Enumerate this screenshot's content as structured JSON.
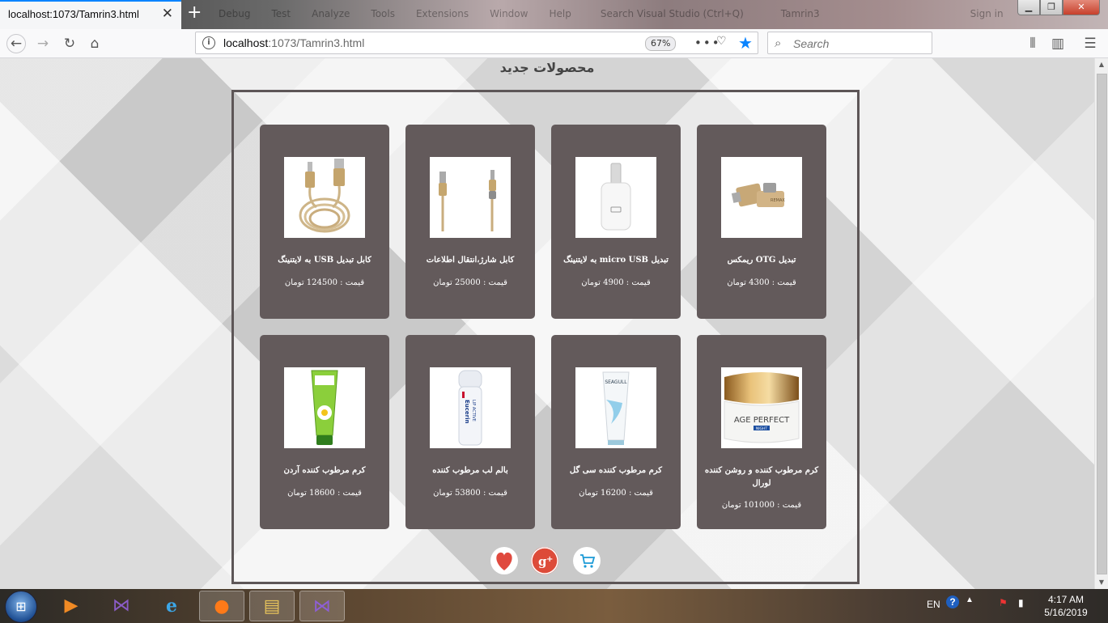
{
  "browser": {
    "tab_title": "localhost:1073/Tamrin3.html",
    "url_host": "localhost",
    "url_path": ":1073/Tamrin3.html",
    "zoom": "67%",
    "search_placeholder": "Search",
    "background_menu": [
      "Debug",
      "Test",
      "Analyze",
      "Tools",
      "Extensions",
      "Window",
      "Help",
      "Search Visual Studio (Ctrl+Q)",
      "Tamrin3",
      "Sign in"
    ],
    "accent_color": "#0a84ff"
  },
  "page": {
    "title": "محصولات جدید",
    "card_color": "#635a5b",
    "products": [
      {
        "name": "تبدیل OTG ریمکس",
        "price": "قیمت : 4300 تومان",
        "icon": "otg-adapter-image"
      },
      {
        "name": "تبدیل micro USB به لایتنینگ",
        "price": "قیمت : 4900 تومان",
        "icon": "micro-usb-adapter-image"
      },
      {
        "name": "کابل شارژ،انتقال اطلاعات",
        "price": "قیمت : 25000 تومان",
        "icon": "charge-cable-image"
      },
      {
        "name": "کابل تبدیل USB به لایتنینگ",
        "price": "قیمت : 124500 تومان",
        "icon": "usb-lightning-cable-image"
      },
      {
        "name": "کرم مرطوب کننده و روشن کننده لورال",
        "price": "قیمت : 101000 تومان",
        "icon": "age-perfect-cream-image"
      },
      {
        "name": "کرم مرطوب کننده سی گل",
        "price": "قیمت : 16200 تومان",
        "icon": "seagull-cream-image"
      },
      {
        "name": "بالم لب مرطوب کننده",
        "price": "قیمت : 53800 تومان",
        "icon": "lip-balm-image"
      },
      {
        "name": "کرم مرطوب کننده آردن",
        "price": "قیمت : 18600 تومان",
        "icon": "arden-cream-image"
      }
    ],
    "image_text": {
      "age_perfect": "AGE PERFECT",
      "night": "NIGHT",
      "eucerin": "Eucerin",
      "lip_active": "LIP ACTIVE",
      "seagull": "SEAGULL"
    },
    "social": [
      "heart-icon",
      "google-plus-icon",
      "cart-icon"
    ]
  },
  "taskbar": {
    "language": "EN",
    "time": "4:17 AM",
    "date": "5/16/2019"
  }
}
